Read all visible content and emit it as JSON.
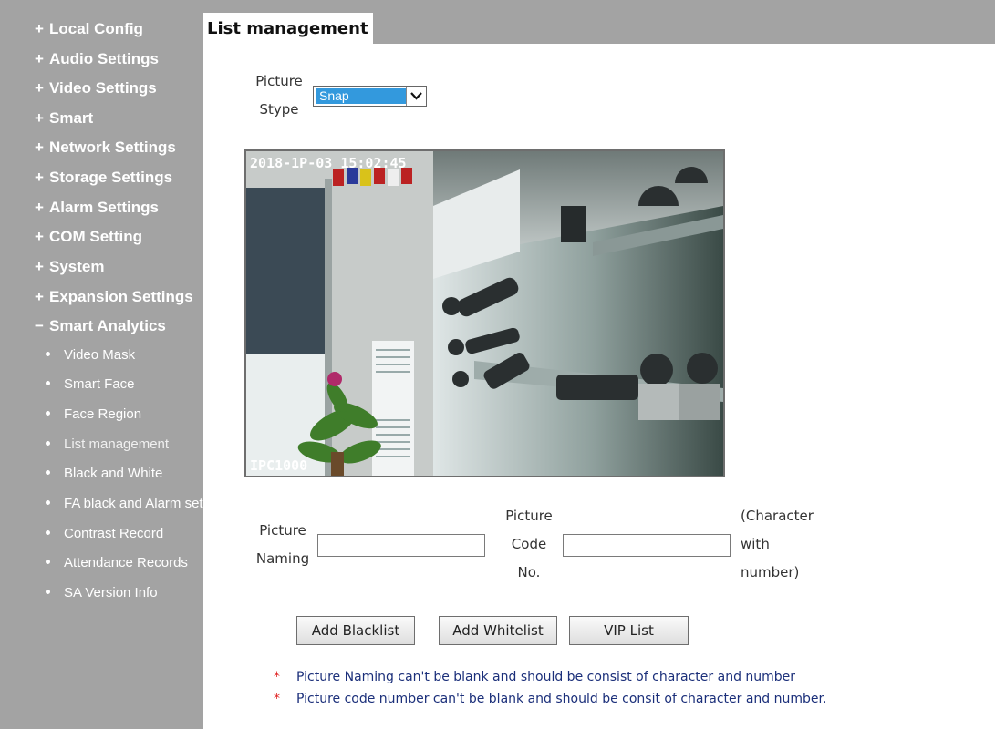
{
  "sidebar": {
    "expand_sign": "+",
    "collapse_sign": "−",
    "menu": [
      {
        "label": "Local Config"
      },
      {
        "label": "Audio Settings"
      },
      {
        "label": "Video Settings"
      },
      {
        "label": "Smart"
      },
      {
        "label": "Network Settings"
      },
      {
        "label": "Storage Settings"
      },
      {
        "label": "Alarm Settings"
      },
      {
        "label": "COM Setting"
      },
      {
        "label": "System"
      },
      {
        "label": "Expansion Settings"
      },
      {
        "label": "Smart Analytics"
      }
    ],
    "subitems": [
      {
        "label": "Video Mask"
      },
      {
        "label": "Smart Face"
      },
      {
        "label": "Face Region"
      },
      {
        "label": "List management"
      },
      {
        "label": "Black and White"
      },
      {
        "label": "FA black and Alarm set"
      },
      {
        "label": "Contrast Record"
      },
      {
        "label": "Attendance Records"
      },
      {
        "label": "SA Version Info"
      }
    ]
  },
  "page": {
    "title": "List management"
  },
  "picture_stype": {
    "label_line1": "Picture",
    "label_line2": "Stype",
    "selected": "Snap"
  },
  "preview": {
    "timestamp": "2018-1P-03 15:02:45",
    "channel_label": "IPC1000"
  },
  "form": {
    "naming_label_line1": "Picture",
    "naming_label_line2": "Naming",
    "naming_value": "",
    "code_label_line1": "Picture",
    "code_label_line2": "Code",
    "code_label_line3": "No.",
    "code_value": "",
    "hint_line1": "(Character",
    "hint_line2": "with",
    "hint_line3": "number)"
  },
  "buttons": {
    "add_blacklist": "Add Blacklist",
    "add_whitelist": "Add Whitelist",
    "vip_list": "VIP List"
  },
  "notes": {
    "marker": "*",
    "note1": "Picture Naming can't be blank and should be consist of character and number",
    "note2": "Picture code number can't be blank and should be consit of character and number."
  },
  "colors": {
    "sidebar_bg": "#a3a3a3",
    "select_highlight": "#3399dd",
    "note_text": "#1b2f7a",
    "note_marker": "#e02020"
  }
}
